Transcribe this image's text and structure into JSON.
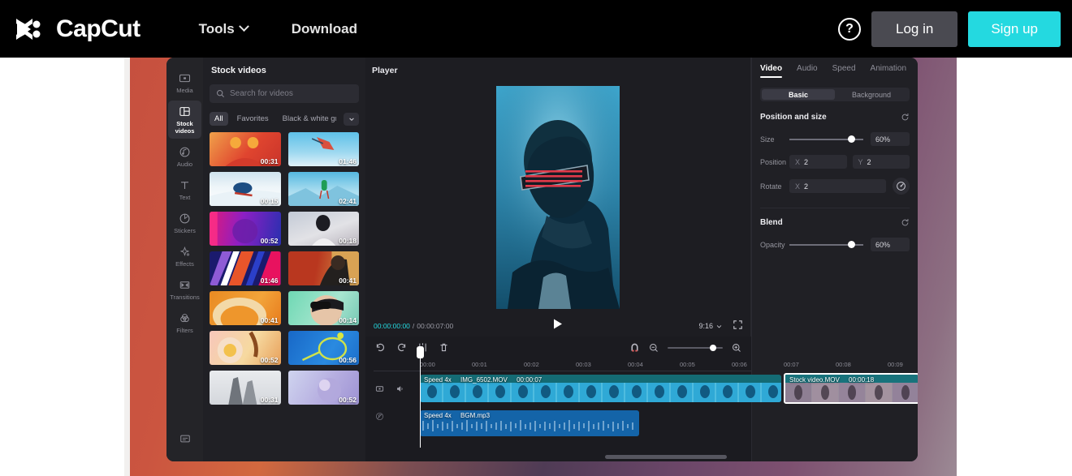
{
  "navbar": {
    "brand": "CapCut",
    "logo_icon": "capcut-logo-icon",
    "links": [
      {
        "label": "Tools",
        "icon": "chevron-down-icon"
      },
      {
        "label": "Download",
        "icon": ""
      }
    ],
    "help_icon": "question-mark-circle-icon",
    "help_label": "?",
    "login_label": "Log in",
    "signup_label": "Sign up",
    "accent_color": "#24d9e0",
    "login_bg": "#4a4a51"
  },
  "rail": {
    "items": [
      {
        "label": "Media",
        "icon": "media-icon",
        "active": false
      },
      {
        "label": "Stock videos",
        "icon": "stock-videos-icon",
        "active": true
      },
      {
        "label": "Audio",
        "icon": "audio-icon",
        "active": false
      },
      {
        "label": "Text",
        "icon": "text-icon",
        "active": false
      },
      {
        "label": "Stickers",
        "icon": "stickers-icon",
        "active": false
      },
      {
        "label": "Effects",
        "icon": "effects-icon",
        "active": false
      },
      {
        "label": "Transitions",
        "icon": "transitions-icon",
        "active": false
      },
      {
        "label": "Filters",
        "icon": "filters-icon",
        "active": false
      }
    ],
    "bottom_icon": "captions-icon"
  },
  "stock_panel": {
    "title": "Stock videos",
    "search": {
      "placeholder": "Search for videos",
      "value": "",
      "icon": "search-icon"
    },
    "chips": [
      {
        "label": "All",
        "active": true
      },
      {
        "label": "Favorites",
        "active": false
      },
      {
        "label": "Black & white group",
        "active": false
      }
    ],
    "chip_more_icon": "chevron-down-icon",
    "thumbnails": [
      {
        "duration": "00:31",
        "desc": "woman-in-red-with-orange-slices"
      },
      {
        "duration": "01:46",
        "desc": "skier-jumping-blue-sky"
      },
      {
        "duration": "00:15",
        "desc": "snowboarder-carving-snow"
      },
      {
        "duration": "02:41",
        "desc": "skier-green-jacket-mountain"
      },
      {
        "duration": "00:52",
        "desc": "neon-pink-purple-portrait"
      },
      {
        "duration": "00:18",
        "desc": "woman-in-white-coat"
      },
      {
        "duration": "01:46",
        "desc": "colored-diagonal-stripes"
      },
      {
        "duration": "00:41",
        "desc": "man-by-red-wall-blinds"
      },
      {
        "duration": "00:41",
        "desc": "orange-abstract-texture"
      },
      {
        "duration": "00:14",
        "desc": "woman-sunglasses-mint-green"
      },
      {
        "duration": "00:52",
        "desc": "donut-closeup-pastel"
      },
      {
        "duration": "00:56",
        "desc": "tennis-racket-blue-ball"
      },
      {
        "duration": "00:31",
        "desc": "grayscale-skyscraper"
      },
      {
        "duration": "00:52",
        "desc": "purple-glass-spheres"
      }
    ]
  },
  "player": {
    "title": "Player",
    "preview_desc": "man-with-red-led-shutter-glasses-blue-light",
    "current_time": "00:00:00:00",
    "separator": "/",
    "total_time": "00:00:07:00",
    "play_icon": "play-icon",
    "ratio_label": "9:16",
    "ratio_icon": "chevron-down-icon",
    "fullscreen_icon": "fullscreen-icon",
    "current_time_color": "#24d9e0"
  },
  "timeline": {
    "tools": [
      {
        "name": "undo-icon",
        "label": "Undo"
      },
      {
        "name": "redo-icon",
        "label": "Redo"
      },
      {
        "name": "split-icon",
        "label": "Split"
      },
      {
        "name": "delete-icon",
        "label": "Delete"
      }
    ],
    "right_tools": {
      "magnet_icon": "magnet-snap-icon",
      "zoom_out_icon": "zoom-out-icon",
      "zoom_in_icon": "zoom-in-icon",
      "zoom_value": 76
    },
    "ruler_ticks": [
      "00:00",
      "00:01",
      "00:02",
      "00:03",
      "00:04",
      "00:05",
      "00:06",
      "00:07",
      "00:08",
      "00:09"
    ],
    "playhead_time": "00:00",
    "video_track": {
      "hide_icon": "hide-track-icon",
      "mute_icon": "speaker-icon",
      "clips": [
        {
          "speed": "Speed 4x",
          "name": "IMG_6502.MOV",
          "duration": "00:00:07",
          "selected": false
        },
        {
          "speed": "",
          "name": "Stock video.MOV",
          "duration": "00:00:18",
          "selected": true
        }
      ]
    },
    "audio_track": {
      "mute_icon": "audio-muted-icon",
      "clips": [
        {
          "speed": "Speed 4x",
          "name": "BGM.mp3",
          "duration": "",
          "selected": false
        }
      ]
    }
  },
  "properties": {
    "tabs": [
      {
        "label": "Video",
        "active": true
      },
      {
        "label": "Audio",
        "active": false
      },
      {
        "label": "Speed",
        "active": false
      },
      {
        "label": "Animation",
        "active": false
      }
    ],
    "segments": [
      {
        "label": "Basic",
        "active": true
      },
      {
        "label": "Background",
        "active": false
      }
    ],
    "position_size": {
      "title": "Position and size",
      "reset_icon": "reset-icon",
      "size_label": "Size",
      "size_value": "60%",
      "position_label": "Position",
      "position_x_axis": "X",
      "position_x": "2",
      "position_y_axis": "Y",
      "position_y": "2",
      "rotate_label": "Rotate",
      "rotate_axis": "X",
      "rotate_value": "2",
      "rotate_dial_icon": "rotate-dial-icon"
    },
    "blend": {
      "title": "Blend",
      "reset_icon": "reset-icon",
      "opacity_label": "Opacity",
      "opacity_value": "60%"
    }
  }
}
